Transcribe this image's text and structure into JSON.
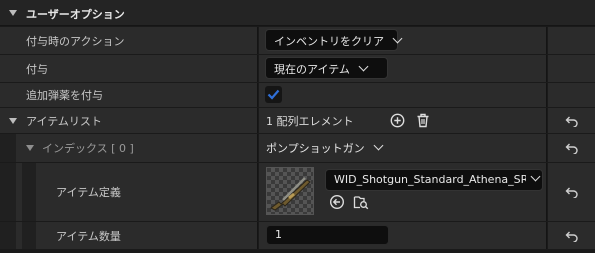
{
  "section": {
    "title": "ユーザーオプション"
  },
  "rows": {
    "grant_action": {
      "label": "付与時のアクション",
      "value": "インベントリをクリア"
    },
    "grant": {
      "label": "付与",
      "value": "現在のアイテム"
    },
    "add_ammo": {
      "label": "追加弾薬を付与",
      "checked": true
    },
    "item_list": {
      "label": "アイテムリスト",
      "count_text": "1 配列エレメント"
    },
    "index": {
      "label": "インデックス [ 0 ]",
      "value": "ポンプショットガン"
    },
    "item_def": {
      "label": "アイテム定義",
      "value": "WID_Shotgun_Standard_Athena_SR_C"
    },
    "item_count": {
      "label": "アイテム数量",
      "value": "1"
    }
  },
  "colors": {
    "checkbox": "#2f6fd9",
    "background": "#1a1a1a",
    "row": "#2b2b2b"
  },
  "icons": [
    "collapse-triangle-icon",
    "add-element-icon",
    "delete-trash-icon",
    "reset-arrow-icon",
    "use-selected-arrow-icon",
    "browse-folder-icon",
    "shotgun-thumbnail"
  ]
}
